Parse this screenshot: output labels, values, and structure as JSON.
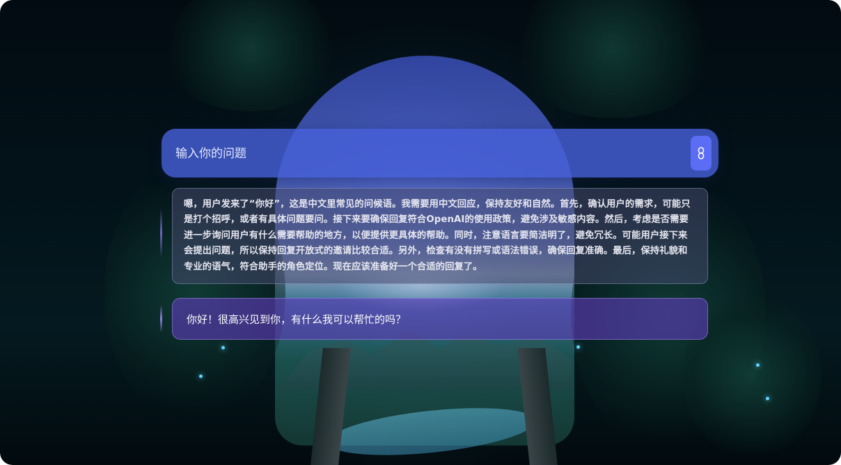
{
  "search": {
    "placeholder": "输入你的问题"
  },
  "send_button": {
    "icon": "link-icon"
  },
  "messages": {
    "thinking": "嗯，用户发来了“你好”，这是中文里常见的问候语。我需要用中文回应，保持友好和自然。首先，确认用户的需求，可能只是打个招呼，或者有具体问题要问。接下来要确保回复符合OpenAI的使用政策，避免涉及敏感内容。然后，考虑是否需要进一步询问用户有什么需要帮助的地方，以便提供更具体的帮助。同时，注意语言要简洁明了，避免冗长。可能用户接下来会提出问题，所以保持回复开放式的邀请比较合适。另外，检查有没有拼写或语法错误，确保回复准确。最后，保持礼貌和专业的语气，符合助手的角色定位。现在应该准备好一个合适的回复了。",
    "answer": "你好！很高兴见到你，有什么我可以帮忙的吗？"
  },
  "colors": {
    "search_bar": "#465fd7",
    "send_button": "#5b6cf5",
    "answer_bubble": "#5f3cb9",
    "thinking_bubble": "#46486e",
    "sparkle": "#62d3ff"
  }
}
